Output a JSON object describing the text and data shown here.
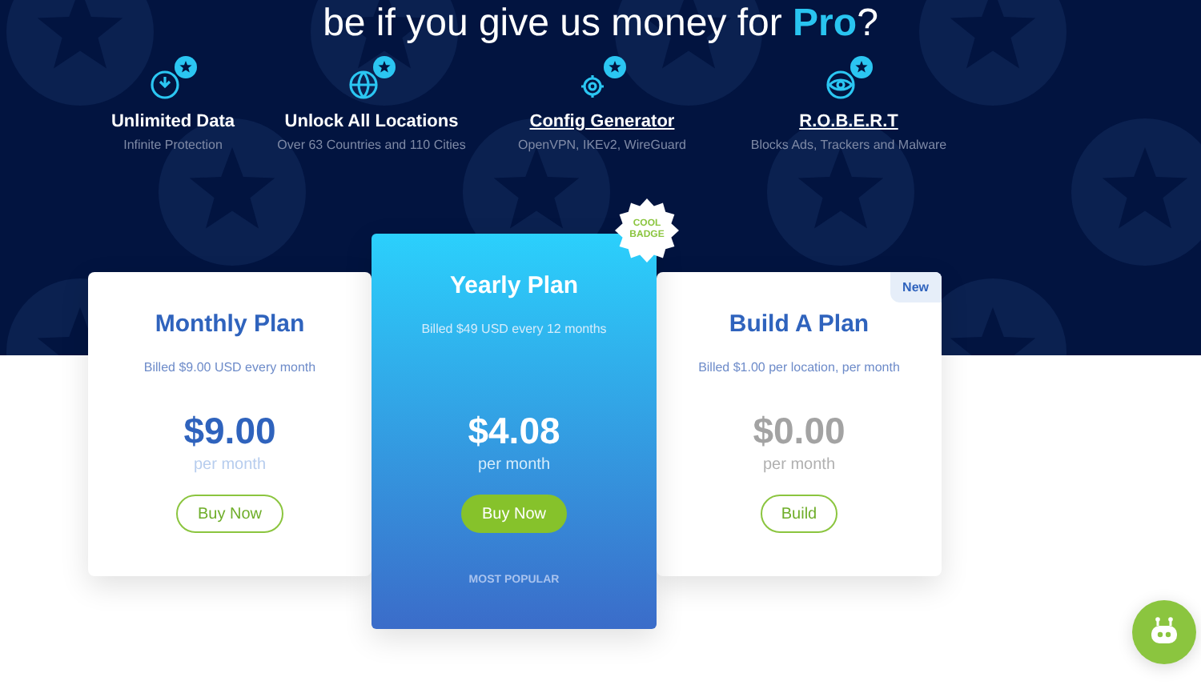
{
  "headline": "be if you give us money for **Pro**?",
  "features": [
    {
      "title": "Unlimited Data",
      "subtitle": "Infinite Protection",
      "link": false
    },
    {
      "title": "Unlock All Locations",
      "subtitle": "Over 63 Countries and 110 Cities",
      "link": false
    },
    {
      "title": "Config Generator",
      "subtitle": "OpenVPN, IKEv2, WireGuard",
      "link": true
    },
    {
      "title": "R.O.B.E.R.T",
      "subtitle": "Blocks Ads, Trackers and Malware",
      "link": true
    }
  ],
  "plans": [
    {
      "kind": "standard",
      "name": "Monthly Plan",
      "billing": "Billed $9.00 USD every month",
      "price": "$9.00",
      "period": "per month",
      "button": "Buy Now"
    },
    {
      "kind": "featured",
      "badge": "COOL BADGE",
      "name": "Yearly Plan",
      "billing": "Billed $49 USD every 12 months",
      "price": "$4.08",
      "period": "per month",
      "button": "Buy Now",
      "footer": "MOST POPULAR"
    },
    {
      "kind": "builder",
      "tag": "New",
      "name": "Build A Plan",
      "billing": "Billed  $1.00 per location, per month",
      "price": "$0.00",
      "period": "per month",
      "button": "Build"
    }
  ]
}
